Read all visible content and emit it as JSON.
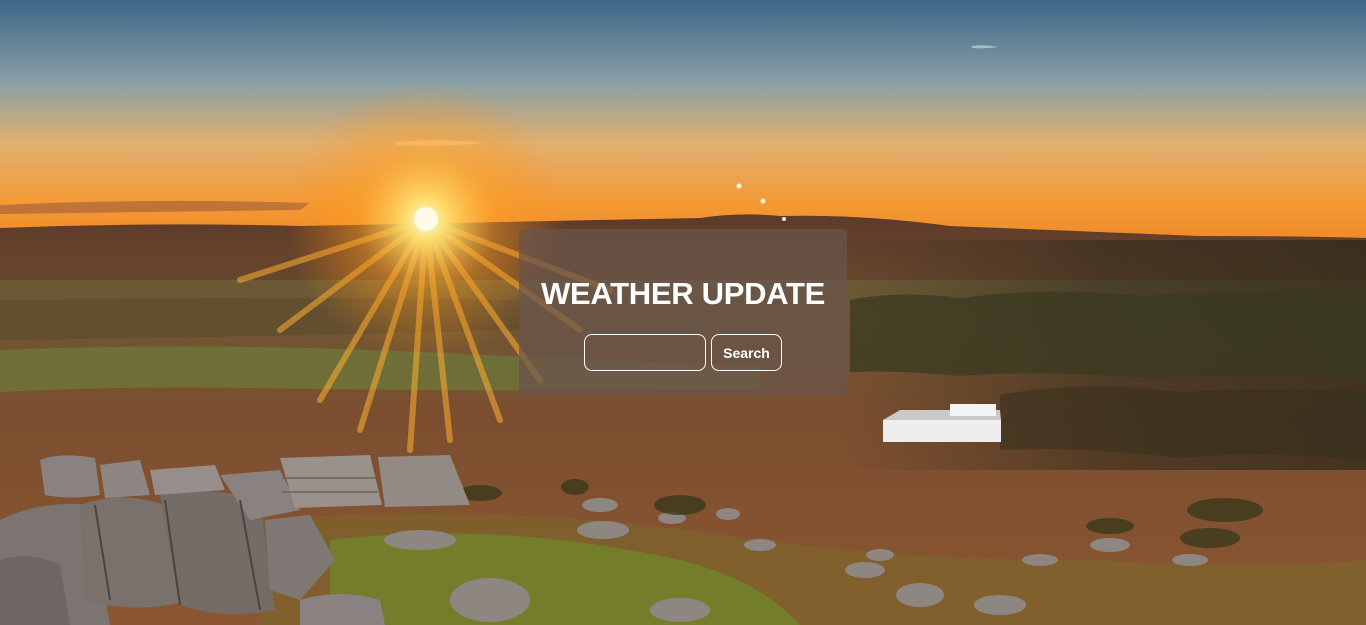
{
  "page": {
    "title": "WEATHER UPDATE"
  },
  "search": {
    "value": "",
    "placeholder": "",
    "button_label": "Search"
  },
  "background": {
    "description_icon": "sunset-landscape-image",
    "colors": {
      "sky_top": "#3f6688",
      "sky_horizon": "#f0902c",
      "sun": "#fff3b0",
      "land": "#7a4a2c",
      "rocks": "#8e8580",
      "grass": "#6f8a2a"
    }
  },
  "card": {
    "background": "#69544c",
    "text_color": "#ffffff"
  }
}
